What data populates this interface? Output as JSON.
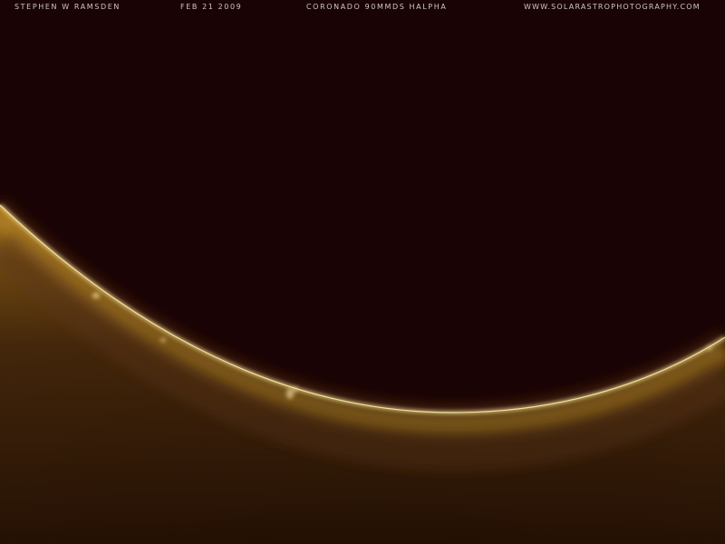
{
  "captions": {
    "photographer": "STEPHEN W RAMSDEN",
    "date": "FEB 21 2009",
    "equipment": "CORONADO 90MMDS HALPHA",
    "website": "WWW.SOLARASTROPHOTOGRAPHY.COM"
  },
  "colors": {
    "sky": "#1a0304",
    "limb": "#f1d67e",
    "chromosphere": "#a87820",
    "disk_deep": "#2e1606"
  },
  "subject": {
    "icon": "sun-limb-icon"
  }
}
